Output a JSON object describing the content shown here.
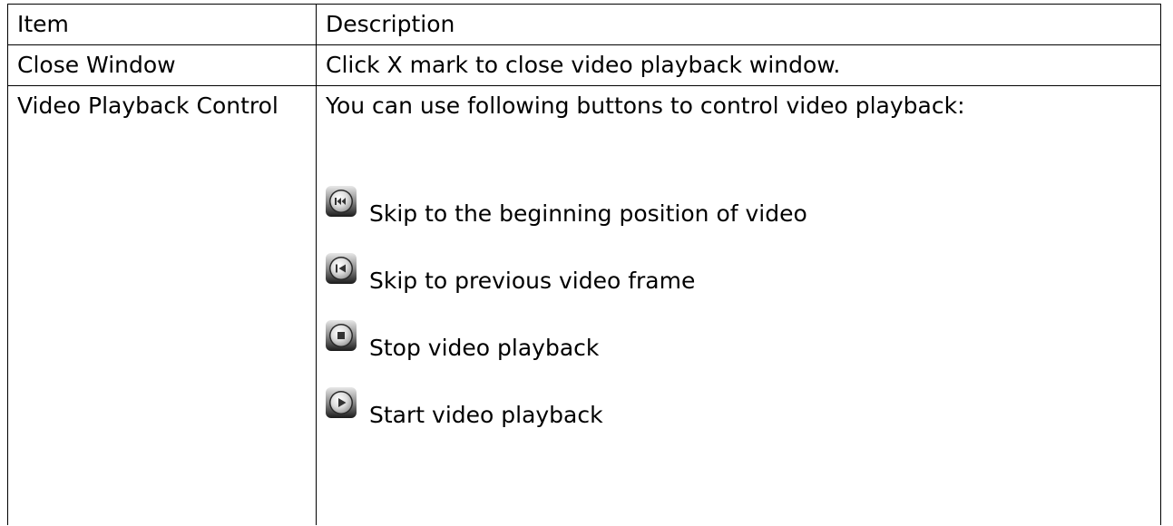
{
  "table": {
    "headers": [
      "Item",
      "Description"
    ],
    "rows": [
      {
        "item": "Close Window",
        "description": "Click X mark to close video playback window."
      },
      {
        "item": "Video Playback Control",
        "intro": "You can use following buttons to control video playback:",
        "controls": [
          {
            "icon": "skip-to-beginning-icon",
            "label": "Skip to the beginning position of video"
          },
          {
            "icon": "previous-frame-icon",
            "label": "Skip to previous video frame"
          },
          {
            "icon": "stop-icon",
            "label": "Stop video playback"
          },
          {
            "icon": "play-icon",
            "label": "Start video playback"
          }
        ]
      }
    ]
  }
}
